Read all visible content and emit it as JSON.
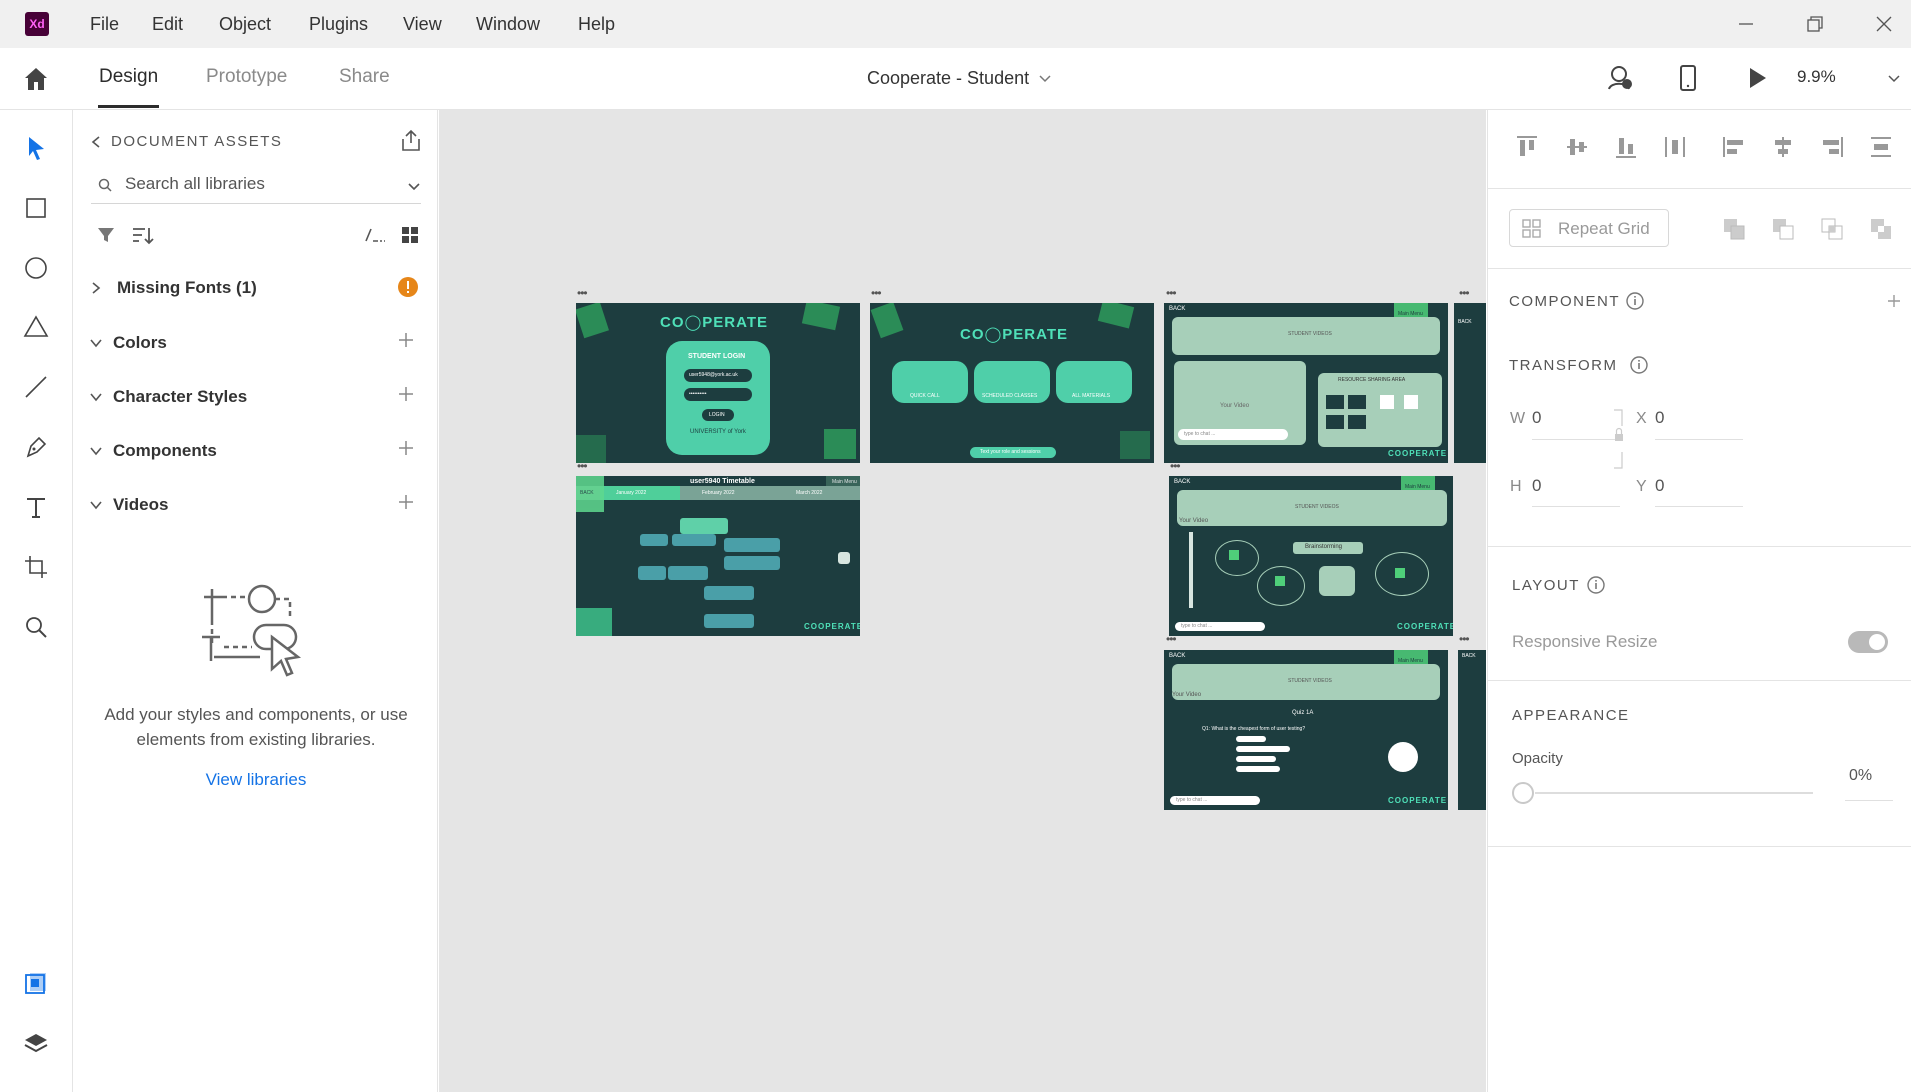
{
  "app": {
    "logo": "Xd"
  },
  "menu": [
    "File",
    "Edit",
    "Object",
    "Plugins",
    "View",
    "Window",
    "Help"
  ],
  "modes": {
    "design": "Design",
    "prototype": "Prototype",
    "share": "Share"
  },
  "document": {
    "title": "Cooperate - Student"
  },
  "zoom": "9.9%",
  "assets": {
    "title": "DOCUMENT ASSETS",
    "search_placeholder": "Search all libraries",
    "sections": {
      "missing_fonts": "Missing Fonts (1)",
      "colors": "Colors",
      "character_styles": "Character Styles",
      "components": "Components",
      "videos": "Videos"
    },
    "empty_text": "Add your styles and components, or use elements from existing libraries.",
    "view_libraries": "View libraries"
  },
  "artboards": {
    "login": {
      "logo": "CO◯PERATE",
      "heading": "STUDENT LOGIN",
      "email": "user5948@york.ac.uk",
      "password": "••••••••••",
      "button": "LOGIN",
      "university": "UNIVERSITY of York"
    },
    "home": {
      "logo": "CO◯PERATE",
      "buttons": [
        "QUICK CALL",
        "SCHEDULED CLASSES",
        "ALL MATERIALS"
      ],
      "footer": "Text your role and sessions"
    },
    "resource": {
      "back": "BACK",
      "main_menu": "Main Menu",
      "student_videos": "STUDENT VIDEOS",
      "your_video": "Your Video",
      "chat": "type to chat ...",
      "area": "RESOURCE SHARING AREA",
      "logo": "COOPERATE"
    },
    "timetable": {
      "title": "user5940 Timetable",
      "main_menu": "Main Menu",
      "back": "BACK",
      "months": [
        "January 2022",
        "February 2022",
        "March 2022"
      ],
      "logo": "COOPERATE"
    },
    "brainstorm": {
      "back": "BACK",
      "main_menu": "Main Menu",
      "student_videos": "STUDENT VIDEOS",
      "your_video": "Your Video",
      "label": "Brainstorming",
      "chat": "type to chat ...",
      "logo": "COOPERATE"
    },
    "quiz": {
      "back": "BACK",
      "main_menu": "Main Menu",
      "student_videos": "STUDENT VIDEOS",
      "your_video": "Your Video",
      "title": "Quiz 1A",
      "question": "Q1: What is the cheapest form of user testing?",
      "chat": "type to chat ...",
      "logo": "COOPERATE"
    },
    "partial": {
      "back": "BACK"
    }
  },
  "inspector": {
    "repeat_grid": "Repeat Grid",
    "component": "COMPONENT",
    "transform": "TRANSFORM",
    "w_label": "W",
    "w": "0",
    "h_label": "H",
    "h": "0",
    "x_label": "X",
    "x": "0",
    "y_label": "Y",
    "y": "0",
    "layout": "LAYOUT",
    "responsive_resize": "Responsive Resize",
    "responsive_resize_on": true,
    "appearance": "APPEARANCE",
    "opacity_label": "Opacity",
    "opacity": "0%"
  },
  "colors": {
    "accent": "#1473e6",
    "warning": "#e68619",
    "artboard_bg": "#1d3d3f",
    "mint": "#4fcfa9",
    "tool_active": "#1473e6"
  }
}
